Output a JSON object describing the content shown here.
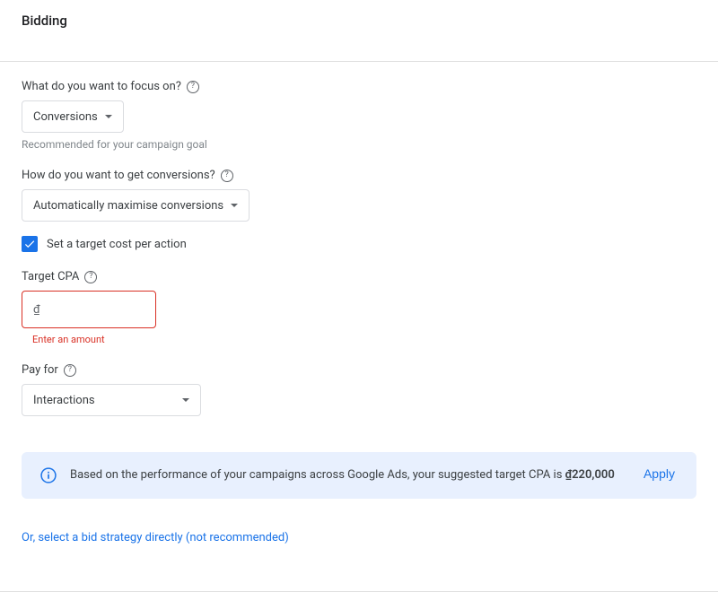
{
  "section": {
    "title": "Bidding"
  },
  "focus": {
    "label": "What do you want to focus on?",
    "value": "Conversions",
    "helper": "Recommended for your campaign goal"
  },
  "conversions": {
    "label": "How do you want to get conversions?",
    "value": "Automatically maximise conversions"
  },
  "checkbox": {
    "label": "Set a target cost per action"
  },
  "targetCpa": {
    "label": "Target CPA",
    "currency": "₫",
    "error": "Enter an amount"
  },
  "payFor": {
    "label": "Pay for",
    "value": "Interactions"
  },
  "info": {
    "text_before": "Based on the performance of your campaigns across Google Ads, your suggested target CPA is ",
    "amount": "₫220,000",
    "apply": "Apply"
  },
  "directLink": {
    "text": "Or, select a bid strategy directly (not recommended)"
  }
}
